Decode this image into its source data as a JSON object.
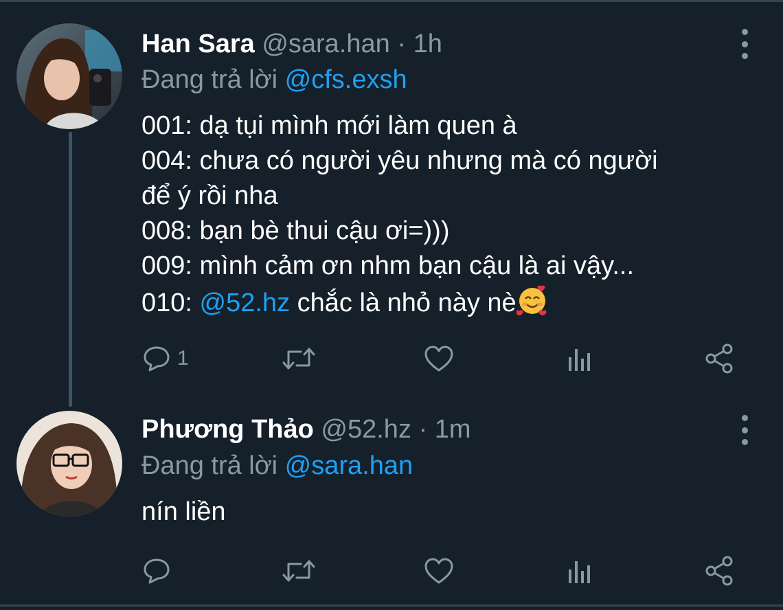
{
  "tweets": [
    {
      "name": "Han Sara",
      "handle": "@sara.han",
      "separator": "·",
      "time": "1h",
      "replying_prefix": "Đang trả lời",
      "replying_to": "@cfs.exsh",
      "lines": [
        "001: dạ tụi mình mới làm quen à",
        "004: chưa có người yêu nhưng mà có người",
        "để ý rồi nha",
        "008: bạn bè thui cậu ơi=)))",
        "009: mình cảm ơn nhm bạn cậu là ai vậy..."
      ],
      "last_line_prefix": "010: ",
      "last_line_mention": "@52.hz",
      "last_line_suffix": " chắc là nhỏ này nè",
      "emoji": "smiling-face-with-hearts",
      "reply_count": "1"
    },
    {
      "name": "Phương Thảo",
      "handle": "@52.hz",
      "separator": "·",
      "time": "1m",
      "replying_prefix": "Đang trả lời",
      "replying_to": "@sara.han",
      "lines": [
        "nín liền"
      ],
      "reply_count": ""
    }
  ],
  "icons": {
    "reply": "reply-icon",
    "retweet": "retweet-icon",
    "like": "heart-icon",
    "analytics": "analytics-icon",
    "share": "share-icon",
    "more": "more-vertical-icon"
  },
  "colors": {
    "background": "#15202b",
    "text": "#ffffff",
    "secondary": "#8899a6",
    "mention": "#1da1f2",
    "thread_line": "#3d5466"
  }
}
